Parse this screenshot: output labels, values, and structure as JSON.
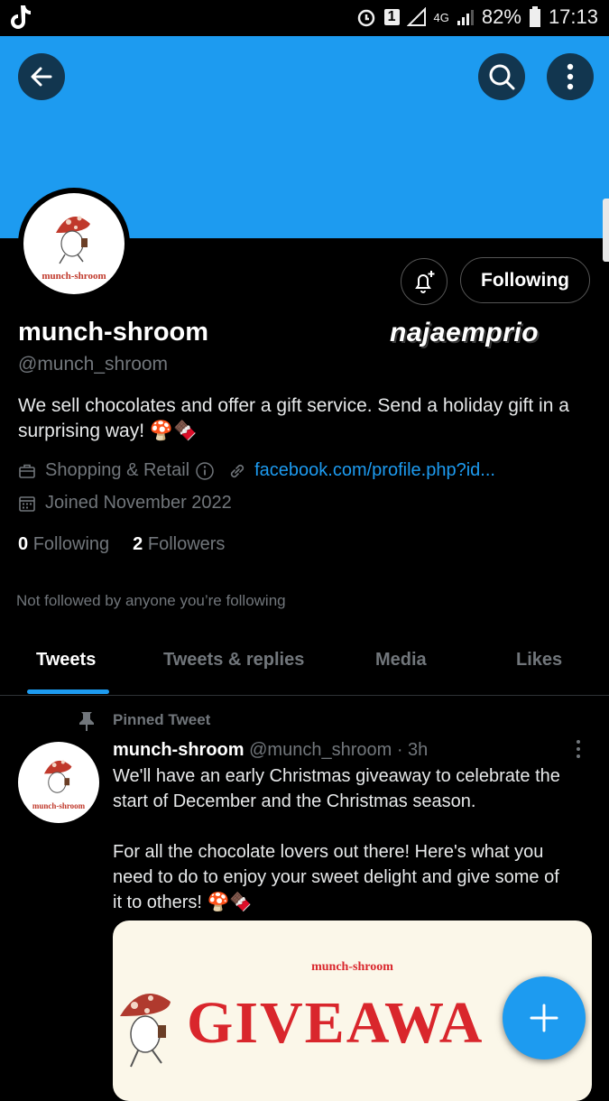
{
  "status_bar": {
    "battery": "82%",
    "time": "17:13",
    "sim_slot": "1",
    "network": "4G"
  },
  "profile": {
    "name": "munch-shroom",
    "handle": "@munch_shroom",
    "avatar_text": "munch-shroom",
    "bio": "We sell chocolates and offer a gift service. Send a holiday gift in a surprising way! 🍄🍫",
    "category": "Shopping & Retail",
    "link": "facebook.com/profile.php?id...",
    "joined": "Joined November 2022",
    "following_count": "0",
    "following_label": "Following",
    "followers_count": "2",
    "followers_label": "Followers",
    "not_followed": "Not followed by anyone you’re following",
    "follow_button_label": "Following"
  },
  "watermark": "najaemprio",
  "tabs": [
    "Tweets",
    "Tweets & replies",
    "Media",
    "Likes"
  ],
  "active_tab": "Tweets",
  "pinned_tweet": {
    "pinned_label": "Pinned Tweet",
    "author": "munch-shroom",
    "handle": "@munch_shroom",
    "time": "· 3h",
    "text_lines": [
      "We'll have an early Christmas giveaway to celebrate the",
      "start of December and the Christmas season.",
      "",
      "For all the chocolate lovers out there! Here's what you",
      "need to do to enjoy your sweet delight and give some of",
      "it to others! 🍄🍫"
    ],
    "media_brand": "munch-shroom",
    "media_title": "GIVEAWA"
  },
  "colors": {
    "banner": "#1d9bf0",
    "accent": "#1d9bf0",
    "muted": "#71767b",
    "giveaway_red": "#d9262c"
  },
  "icons": [
    "tiktok-icon",
    "alarm-icon",
    "back-arrow-icon",
    "search-icon",
    "more-vertical-icon",
    "bell-plus-icon",
    "briefcase-icon",
    "info-icon",
    "link-icon",
    "calendar-icon",
    "pin-icon",
    "compose-plus-icon"
  ]
}
